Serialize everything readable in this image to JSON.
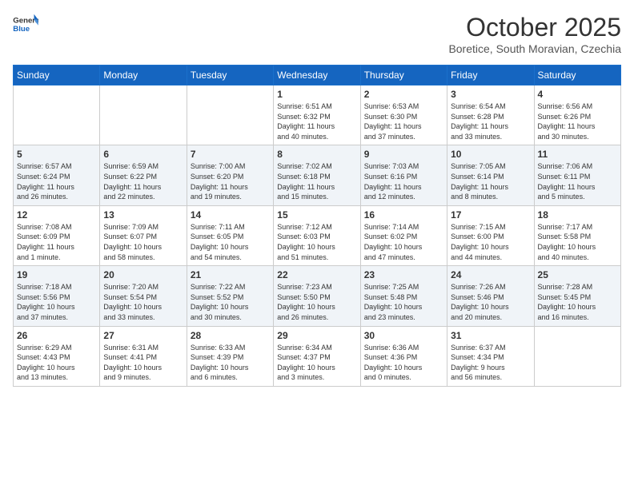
{
  "header": {
    "logo_line1": "General",
    "logo_line2": "Blue",
    "month_year": "October 2025",
    "location": "Boretice, South Moravian, Czechia"
  },
  "days_of_week": [
    "Sunday",
    "Monday",
    "Tuesday",
    "Wednesday",
    "Thursday",
    "Friday",
    "Saturday"
  ],
  "weeks": [
    [
      {
        "day": "",
        "info": ""
      },
      {
        "day": "",
        "info": ""
      },
      {
        "day": "",
        "info": ""
      },
      {
        "day": "1",
        "info": "Sunrise: 6:51 AM\nSunset: 6:32 PM\nDaylight: 11 hours\nand 40 minutes."
      },
      {
        "day": "2",
        "info": "Sunrise: 6:53 AM\nSunset: 6:30 PM\nDaylight: 11 hours\nand 37 minutes."
      },
      {
        "day": "3",
        "info": "Sunrise: 6:54 AM\nSunset: 6:28 PM\nDaylight: 11 hours\nand 33 minutes."
      },
      {
        "day": "4",
        "info": "Sunrise: 6:56 AM\nSunset: 6:26 PM\nDaylight: 11 hours\nand 30 minutes."
      }
    ],
    [
      {
        "day": "5",
        "info": "Sunrise: 6:57 AM\nSunset: 6:24 PM\nDaylight: 11 hours\nand 26 minutes."
      },
      {
        "day": "6",
        "info": "Sunrise: 6:59 AM\nSunset: 6:22 PM\nDaylight: 11 hours\nand 22 minutes."
      },
      {
        "day": "7",
        "info": "Sunrise: 7:00 AM\nSunset: 6:20 PM\nDaylight: 11 hours\nand 19 minutes."
      },
      {
        "day": "8",
        "info": "Sunrise: 7:02 AM\nSunset: 6:18 PM\nDaylight: 11 hours\nand 15 minutes."
      },
      {
        "day": "9",
        "info": "Sunrise: 7:03 AM\nSunset: 6:16 PM\nDaylight: 11 hours\nand 12 minutes."
      },
      {
        "day": "10",
        "info": "Sunrise: 7:05 AM\nSunset: 6:14 PM\nDaylight: 11 hours\nand 8 minutes."
      },
      {
        "day": "11",
        "info": "Sunrise: 7:06 AM\nSunset: 6:11 PM\nDaylight: 11 hours\nand 5 minutes."
      }
    ],
    [
      {
        "day": "12",
        "info": "Sunrise: 7:08 AM\nSunset: 6:09 PM\nDaylight: 11 hours\nand 1 minute."
      },
      {
        "day": "13",
        "info": "Sunrise: 7:09 AM\nSunset: 6:07 PM\nDaylight: 10 hours\nand 58 minutes."
      },
      {
        "day": "14",
        "info": "Sunrise: 7:11 AM\nSunset: 6:05 PM\nDaylight: 10 hours\nand 54 minutes."
      },
      {
        "day": "15",
        "info": "Sunrise: 7:12 AM\nSunset: 6:03 PM\nDaylight: 10 hours\nand 51 minutes."
      },
      {
        "day": "16",
        "info": "Sunrise: 7:14 AM\nSunset: 6:02 PM\nDaylight: 10 hours\nand 47 minutes."
      },
      {
        "day": "17",
        "info": "Sunrise: 7:15 AM\nSunset: 6:00 PM\nDaylight: 10 hours\nand 44 minutes."
      },
      {
        "day": "18",
        "info": "Sunrise: 7:17 AM\nSunset: 5:58 PM\nDaylight: 10 hours\nand 40 minutes."
      }
    ],
    [
      {
        "day": "19",
        "info": "Sunrise: 7:18 AM\nSunset: 5:56 PM\nDaylight: 10 hours\nand 37 minutes."
      },
      {
        "day": "20",
        "info": "Sunrise: 7:20 AM\nSunset: 5:54 PM\nDaylight: 10 hours\nand 33 minutes."
      },
      {
        "day": "21",
        "info": "Sunrise: 7:22 AM\nSunset: 5:52 PM\nDaylight: 10 hours\nand 30 minutes."
      },
      {
        "day": "22",
        "info": "Sunrise: 7:23 AM\nSunset: 5:50 PM\nDaylight: 10 hours\nand 26 minutes."
      },
      {
        "day": "23",
        "info": "Sunrise: 7:25 AM\nSunset: 5:48 PM\nDaylight: 10 hours\nand 23 minutes."
      },
      {
        "day": "24",
        "info": "Sunrise: 7:26 AM\nSunset: 5:46 PM\nDaylight: 10 hours\nand 20 minutes."
      },
      {
        "day": "25",
        "info": "Sunrise: 7:28 AM\nSunset: 5:45 PM\nDaylight: 10 hours\nand 16 minutes."
      }
    ],
    [
      {
        "day": "26",
        "info": "Sunrise: 6:29 AM\nSunset: 4:43 PM\nDaylight: 10 hours\nand 13 minutes."
      },
      {
        "day": "27",
        "info": "Sunrise: 6:31 AM\nSunset: 4:41 PM\nDaylight: 10 hours\nand 9 minutes."
      },
      {
        "day": "28",
        "info": "Sunrise: 6:33 AM\nSunset: 4:39 PM\nDaylight: 10 hours\nand 6 minutes."
      },
      {
        "day": "29",
        "info": "Sunrise: 6:34 AM\nSunset: 4:37 PM\nDaylight: 10 hours\nand 3 minutes."
      },
      {
        "day": "30",
        "info": "Sunrise: 6:36 AM\nSunset: 4:36 PM\nDaylight: 10 hours\nand 0 minutes."
      },
      {
        "day": "31",
        "info": "Sunrise: 6:37 AM\nSunset: 4:34 PM\nDaylight: 9 hours\nand 56 minutes."
      },
      {
        "day": "",
        "info": ""
      }
    ]
  ]
}
